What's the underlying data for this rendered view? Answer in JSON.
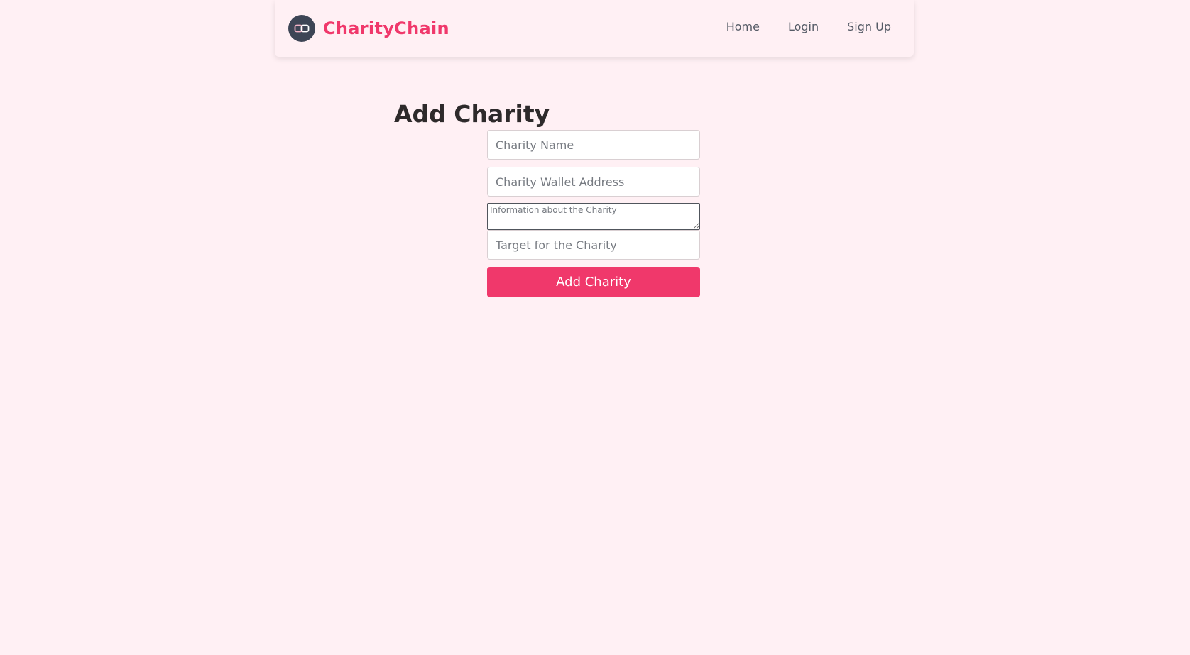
{
  "brand": {
    "name": "CharityChain",
    "logo_icon": "chain-link-icon"
  },
  "nav": {
    "links": [
      "Home",
      "Login",
      "Sign Up"
    ]
  },
  "form": {
    "title": "Add Charity",
    "name_placeholder": "Charity Name",
    "wallet_placeholder": "Charity Wallet Address",
    "info_placeholder": "Information about the Charity",
    "target_placeholder": "Target for the Charity",
    "submit_label": "Add Charity"
  },
  "colors": {
    "accent": "#f0386b",
    "background": "#fff0f4",
    "logo_bg": "#3d4555"
  }
}
